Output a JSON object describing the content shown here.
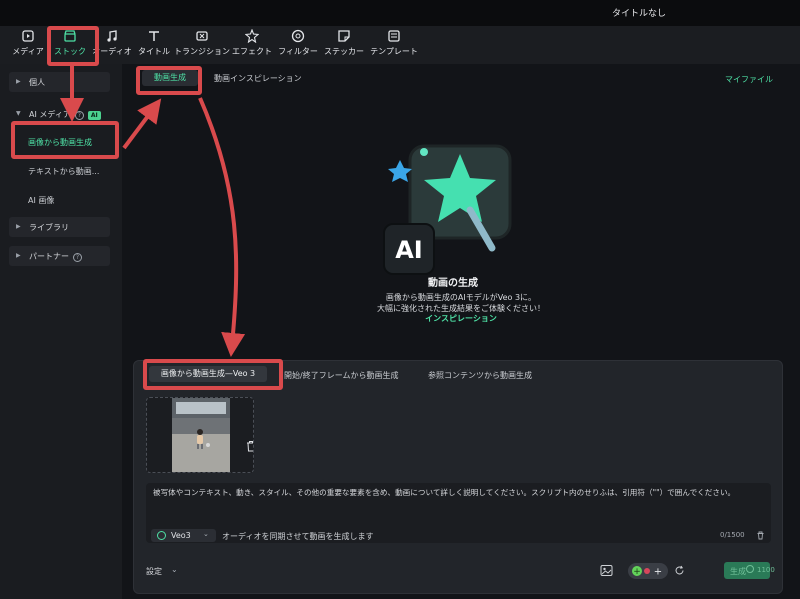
{
  "window": {
    "title": "タイトルなし"
  },
  "toolbar": {
    "items": [
      {
        "label": "メディア",
        "icon": "media-icon"
      },
      {
        "label": "ストック",
        "icon": "stock-icon"
      },
      {
        "label": "オーディオ",
        "icon": "audio-icon"
      },
      {
        "label": "タイトル",
        "icon": "title-icon"
      },
      {
        "label": "トランジション",
        "icon": "transition-icon"
      },
      {
        "label": "エフェクト",
        "icon": "effect-icon"
      },
      {
        "label": "フィルター",
        "icon": "filter-icon"
      },
      {
        "label": "ステッカー",
        "icon": "sticker-icon"
      },
      {
        "label": "テンプレート",
        "icon": "template-icon"
      }
    ]
  },
  "sidebar": {
    "personal": "個人",
    "ai_media": "AI メディア",
    "ai_badge": "AI",
    "help_mark": "?",
    "sub_items": [
      "画像から動画生成",
      "テキストから動画...",
      "AI 画像"
    ],
    "library": "ライブラリ",
    "partner": "パートナー"
  },
  "main": {
    "tabs": [
      "動画生成",
      "動画インスピレーション"
    ],
    "my_files": "マイファイル",
    "hero": {
      "title": "動画の生成",
      "desc1": "画像から動画生成のAIモデルがVeo 3に。",
      "desc2": "大幅に強化された生成結果をご体験ください！",
      "link": "インスピレーション",
      "logo_text": "AI"
    }
  },
  "panel": {
    "tabs": [
      "画像から動画生成—Veo 3",
      "開始/終了フレームから動画生成",
      "参照コンテンツから動画生成"
    ],
    "prompt_text": "被写体やコンテキスト、動き、スタイル、その他の重要な要素を含め、動画について詳しく説明してください。スクリプト内のせりふは、引用符（\"\"）で囲んでください。",
    "model": "Veo3",
    "audio_sync": "オーディオを同期させて動画を生成します",
    "counter": "0/1500",
    "settings": "設定",
    "generate": "生成",
    "generate_credits": "1100"
  },
  "colors": {
    "accent": "#4ee0a5",
    "highlight": "#d94a4c",
    "bg": "#121418"
  }
}
